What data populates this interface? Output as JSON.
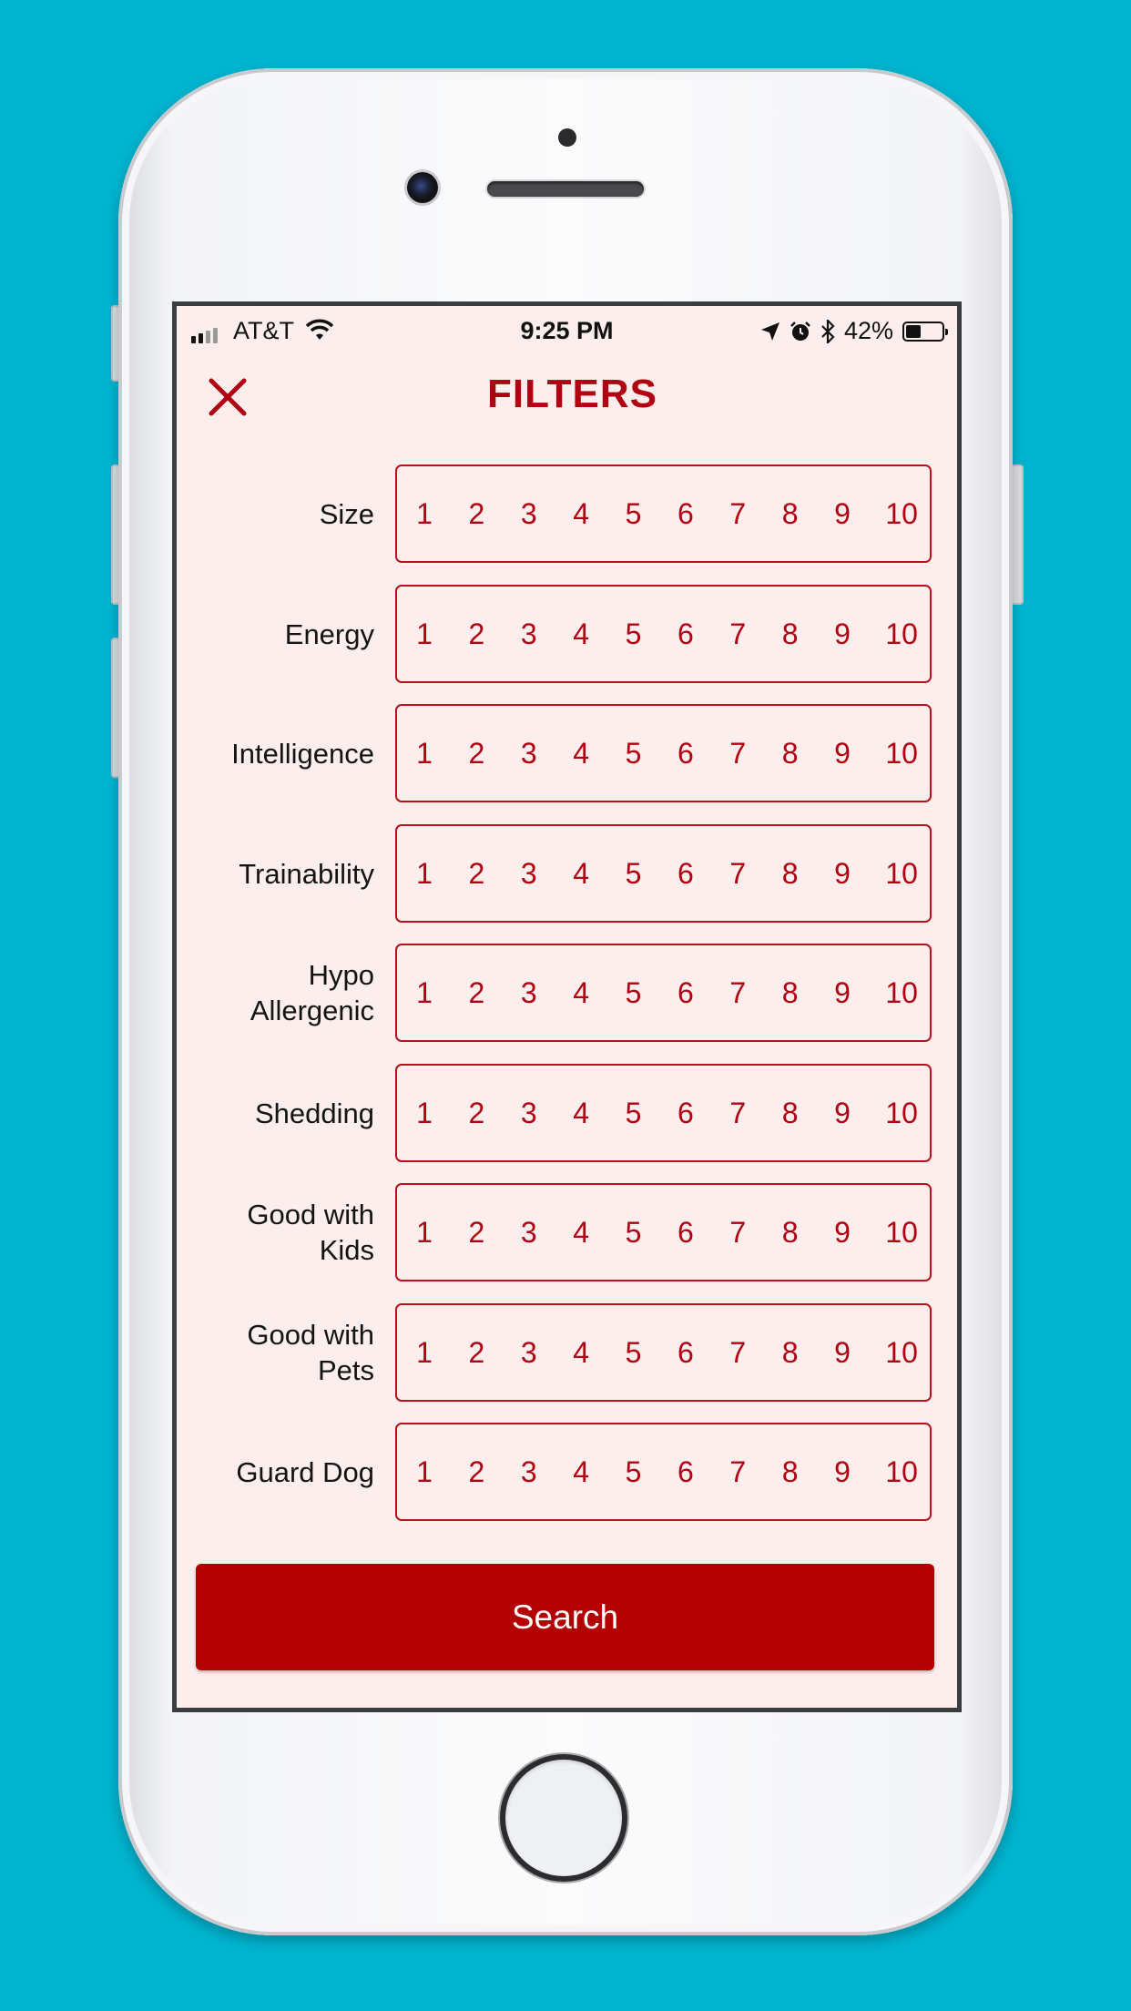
{
  "status_bar": {
    "carrier": "AT&T",
    "time": "9:25 PM",
    "battery_percent": "42%",
    "battery_level": 0.42,
    "icons": [
      "signal-icon",
      "wifi-icon",
      "location-icon",
      "alarm-icon",
      "bluetooth-icon",
      "battery-icon"
    ]
  },
  "header": {
    "title": "FILTERS",
    "close_icon": "close-icon"
  },
  "scale": [
    "1",
    "2",
    "3",
    "4",
    "5",
    "6",
    "7",
    "8",
    "9",
    "10"
  ],
  "filters": [
    {
      "label": "Size"
    },
    {
      "label": "Energy"
    },
    {
      "label": "Intelligence"
    },
    {
      "label": "Trainability"
    },
    {
      "label": "Hypo\nAllergenic"
    },
    {
      "label": "Shedding"
    },
    {
      "label": "Good with\nKids"
    },
    {
      "label": "Good with\nPets"
    },
    {
      "label": "Guard Dog"
    }
  ],
  "search_button": {
    "label": "Search"
  },
  "colors": {
    "background": "#00b4cf",
    "screen": "#fdeeee",
    "accent": "#b00012",
    "button": "#b30000"
  }
}
